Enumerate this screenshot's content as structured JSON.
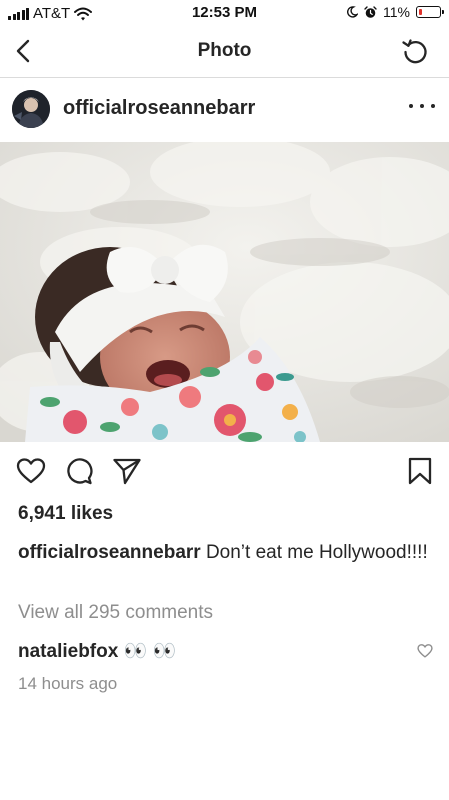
{
  "status_bar": {
    "carrier": "AT&T",
    "time": "12:53 PM",
    "battery_percent": "11%",
    "battery_level": 0.11,
    "icons": [
      "signal-icon",
      "wifi-icon",
      "moon-icon",
      "alarm-icon",
      "battery-icon"
    ]
  },
  "nav": {
    "title": "Photo",
    "back_icon": "chevron-left-icon",
    "refresh_icon": "refresh-icon"
  },
  "post": {
    "username": "officialroseannebarr",
    "more_icon": "more-horizontal-icon",
    "photo_description": "",
    "likes": "6,941 likes",
    "caption": {
      "username": "officialroseannebarr",
      "text": "Don’t eat me Hollywood!!!!"
    },
    "view_comments": "View all 295 comments",
    "comment": {
      "username": "nataliebfox",
      "text": "👀 👀"
    },
    "timestamp": "14 hours ago"
  },
  "actions": {
    "like_icon": "heart-icon",
    "comment_icon": "comment-icon",
    "share_icon": "paper-plane-icon",
    "save_icon": "bookmark-icon"
  },
  "colors": {
    "text": "#262626",
    "secondary": "#8e8e8e",
    "divider": "#dbdbdb",
    "battery_low": "#e0332b"
  }
}
